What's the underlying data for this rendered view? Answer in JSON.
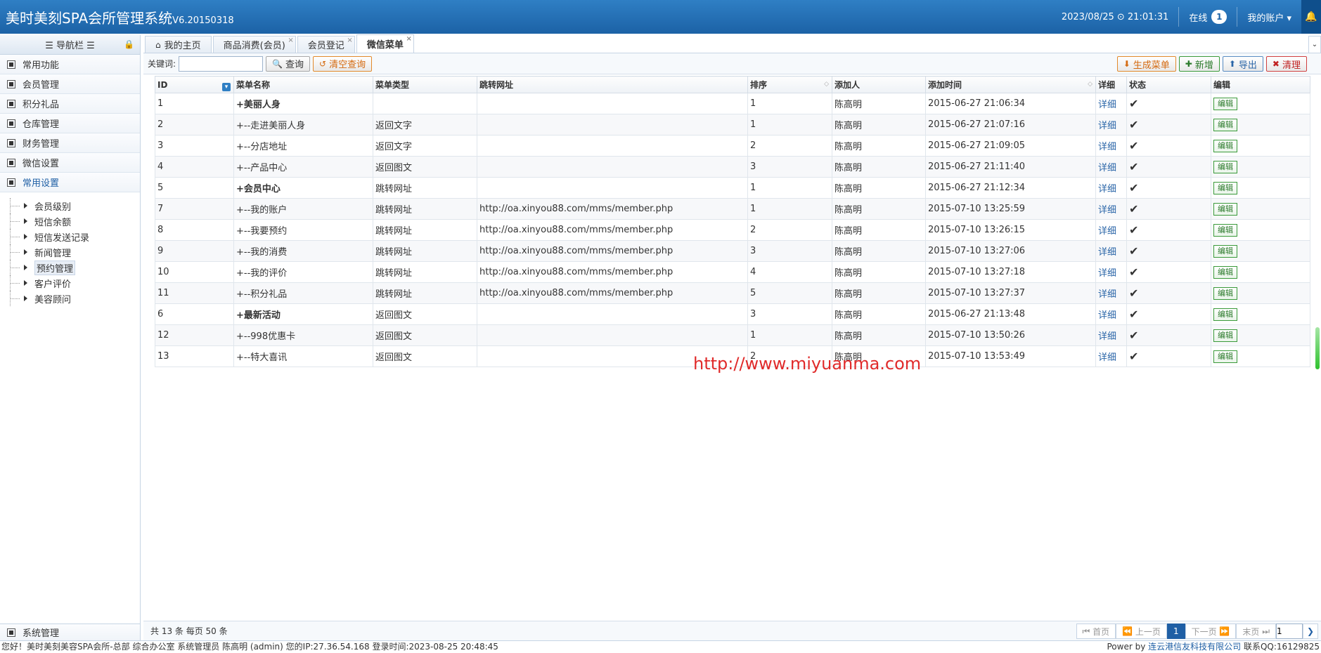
{
  "header": {
    "title": "美时美刻SPA会所管理系统",
    "version": "V6.20150318",
    "datetime": "2023/08/25 ⊙ 21:01:31",
    "online_label": "在线",
    "online_count": "1",
    "account_label": "我的账户 ▾"
  },
  "sidebar": {
    "title": "☰ 导航栏 ☰",
    "items": [
      {
        "label": "常用功能"
      },
      {
        "label": "会员管理"
      },
      {
        "label": "积分礼品"
      },
      {
        "label": "仓库管理"
      },
      {
        "label": "财务管理"
      },
      {
        "label": "微信设置"
      },
      {
        "label": "常用设置"
      }
    ],
    "subitems": [
      {
        "label": "会员级别"
      },
      {
        "label": "短信余额"
      },
      {
        "label": "短信发送记录"
      },
      {
        "label": "新闻管理"
      },
      {
        "label": "预约管理"
      },
      {
        "label": "客户评价"
      },
      {
        "label": "美容顾问"
      }
    ],
    "bottom": "系统管理"
  },
  "tabs": [
    {
      "label": "我的主页"
    },
    {
      "label": "商品消费(会员)"
    },
    {
      "label": "会员登记"
    },
    {
      "label": "微信菜单"
    }
  ],
  "toolbar": {
    "keyword_label": "关键词:",
    "keyword_value": "",
    "search": "查询",
    "clear": "清空查询",
    "generate": "生成菜单",
    "add": "新增",
    "export": "导出",
    "clean": "清理"
  },
  "grid": {
    "columns": [
      "ID",
      "菜单名称",
      "菜单类型",
      "跳转网址",
      "排序",
      "添加人",
      "添加时间",
      "详细",
      "状态",
      "编辑"
    ],
    "detail_label": "详细",
    "edit_label": "编辑",
    "rows": [
      {
        "id": "1",
        "name": "+美丽人身",
        "type": "",
        "url": "",
        "sort": "1",
        "by": "陈高明",
        "time": "2015-06-27 21:06:34",
        "bold": true
      },
      {
        "id": "2",
        "name": "+--走进美丽人身",
        "type": "返回文字",
        "url": "",
        "sort": "1",
        "by": "陈高明",
        "time": "2015-06-27 21:07:16",
        "bold": false
      },
      {
        "id": "3",
        "name": "+--分店地址",
        "type": "返回文字",
        "url": "",
        "sort": "2",
        "by": "陈高明",
        "time": "2015-06-27 21:09:05",
        "bold": false
      },
      {
        "id": "4",
        "name": "+--产品中心",
        "type": "返回图文",
        "url": "",
        "sort": "3",
        "by": "陈高明",
        "time": "2015-06-27 21:11:40",
        "bold": false
      },
      {
        "id": "5",
        "name": "+会员中心",
        "type": "跳转网址",
        "url": "",
        "sort": "1",
        "by": "陈高明",
        "time": "2015-06-27 21:12:34",
        "bold": true
      },
      {
        "id": "7",
        "name": "+--我的账户",
        "type": "跳转网址",
        "url": "http://oa.xinyou88.com/mms/member.php",
        "sort": "1",
        "by": "陈高明",
        "time": "2015-07-10 13:25:59",
        "bold": false
      },
      {
        "id": "8",
        "name": "+--我要预约",
        "type": "跳转网址",
        "url": "http://oa.xinyou88.com/mms/member.php",
        "sort": "2",
        "by": "陈高明",
        "time": "2015-07-10 13:26:15",
        "bold": false
      },
      {
        "id": "9",
        "name": "+--我的消费",
        "type": "跳转网址",
        "url": "http://oa.xinyou88.com/mms/member.php",
        "sort": "3",
        "by": "陈高明",
        "time": "2015-07-10 13:27:06",
        "bold": false
      },
      {
        "id": "10",
        "name": "+--我的评价",
        "type": "跳转网址",
        "url": "http://oa.xinyou88.com/mms/member.php",
        "sort": "4",
        "by": "陈高明",
        "time": "2015-07-10 13:27:18",
        "bold": false
      },
      {
        "id": "11",
        "name": "+--积分礼品",
        "type": "跳转网址",
        "url": "http://oa.xinyou88.com/mms/member.php",
        "sort": "5",
        "by": "陈高明",
        "time": "2015-07-10 13:27:37",
        "bold": false
      },
      {
        "id": "6",
        "name": "+最新活动",
        "type": "返回图文",
        "url": "",
        "sort": "3",
        "by": "陈高明",
        "time": "2015-06-27 21:13:48",
        "bold": true
      },
      {
        "id": "12",
        "name": "+--998优惠卡",
        "type": "返回图文",
        "url": "",
        "sort": "1",
        "by": "陈高明",
        "time": "2015-07-10 13:50:26",
        "bold": false
      },
      {
        "id": "13",
        "name": "+--特大喜讯",
        "type": "返回图文",
        "url": "",
        "sort": "2",
        "by": "陈高明",
        "time": "2015-07-10 13:53:49",
        "bold": false
      }
    ]
  },
  "watermark": "http://www.miyuanma.com",
  "pager": {
    "info": "共 13 条 每页 50 条",
    "first": "首页",
    "prev": "上一页",
    "current": "1",
    "next": "下一页",
    "last": "末页",
    "page_input": "1"
  },
  "footer": {
    "left": "您好！美时美刻美容SPA会所-总部 综合办公室 系统管理员 陈高明 (admin) 您的IP:27.36.54.168 登录时间:2023-08-25 20:48:45",
    "power": "Power by",
    "company": "连云港信友科技有限公司",
    "qq": "联系QQ:16129825"
  }
}
